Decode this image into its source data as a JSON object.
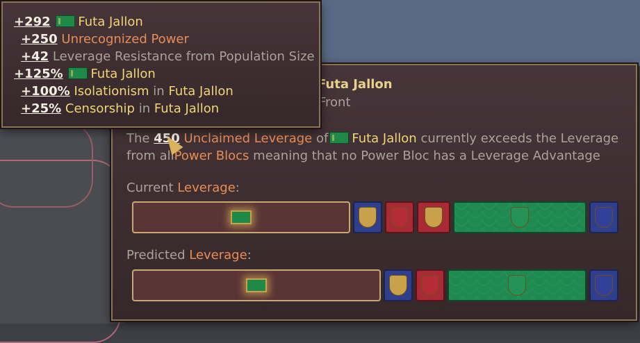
{
  "tooltip_small": {
    "lines": [
      {
        "value": "+292",
        "flag": true,
        "text": "Futa Jallon",
        "text_color": "white"
      },
      {
        "value": "+250",
        "text": "Unrecognized Power",
        "text_color": "orange"
      },
      {
        "value": "+42",
        "text": "Leverage Resistance from Population Size",
        "text_color": "gray"
      },
      {
        "value": "+125%",
        "flag": true,
        "text": "Futa Jallon",
        "text_color": "white"
      },
      {
        "value": "+100%",
        "text": "Isolationism",
        "suffix": "in",
        "target": "Futa Jallon"
      },
      {
        "value": "+25%",
        "text": "Censorship",
        "suffix": "in",
        "target": "Futa Jallon"
      }
    ]
  },
  "tooltip_main": {
    "title": "Futa Jallon",
    "subtitle": "Front",
    "desc_line1": {
      "pre": "The",
      "value": "450",
      "term": "Unclaimed Leverage",
      "of": "of",
      "country": "Futa Jallon",
      "post": "currently exceeds the Leverage"
    },
    "desc_line2": {
      "pre": "from all",
      "term": "Power Blocs",
      "post": "meaning that no Power Bloc has a Leverage Advantage"
    },
    "current_label": {
      "pre": "Current",
      "term": "Leverage",
      "post": ":"
    },
    "predicted_label": {
      "pre": "Predicted",
      "term": "Leverage",
      "post": ":"
    }
  },
  "current_bar": [
    {
      "kind": "unclaimed",
      "country": "Futa Jallon"
    },
    {
      "kind": "blue"
    },
    {
      "kind": "red"
    },
    {
      "kind": "red"
    },
    {
      "kind": "green"
    },
    {
      "kind": "blue"
    }
  ],
  "predicted_bar": [
    {
      "kind": "unclaimed",
      "country": "Futa Jallon"
    },
    {
      "kind": "blue"
    },
    {
      "kind": "red"
    },
    {
      "kind": "green"
    },
    {
      "kind": "blue"
    }
  ],
  "colors": {
    "accent_orange": "#e88d55",
    "accent_yellow": "#f0d675",
    "border_gold": "#8a7552"
  }
}
